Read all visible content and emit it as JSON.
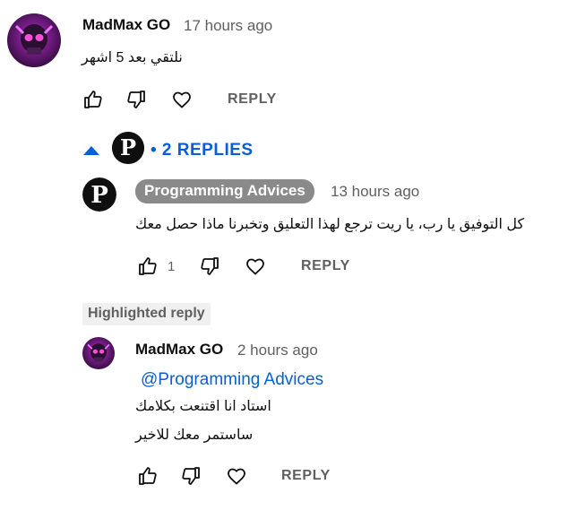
{
  "comment": {
    "author": "MadMax GO",
    "time": "17 hours ago",
    "text": "نلتقي بعد 5 اشهر",
    "reply_label": "REPLY",
    "avatar_icon": "skull-avatar-icon"
  },
  "replies_toggle": {
    "label": "• 2 REPLIES",
    "icon": "caret-up-icon"
  },
  "reply1": {
    "author": "Programming Advices",
    "time": "13 hours ago",
    "text": "كل التوفيق يا رب، يا ريت ترجع لهذا التعليق وتخبرنا ماذا حصل معك",
    "likes": "1",
    "reply_label": "REPLY",
    "avatar_letter": "P"
  },
  "highlighted_label": "Highlighted reply",
  "reply2": {
    "author": "MadMax GO",
    "time": "2 hours ago",
    "mention": "@Programming Advices",
    "line1": "استاد انا اقتنعت بكلامك",
    "line2": "ساستمر معك للاخير",
    "reply_label": "REPLY"
  },
  "colors": {
    "link_blue": "#065fd4",
    "badge_gray": "#8a8a8a",
    "secondary_text": "#606060"
  }
}
